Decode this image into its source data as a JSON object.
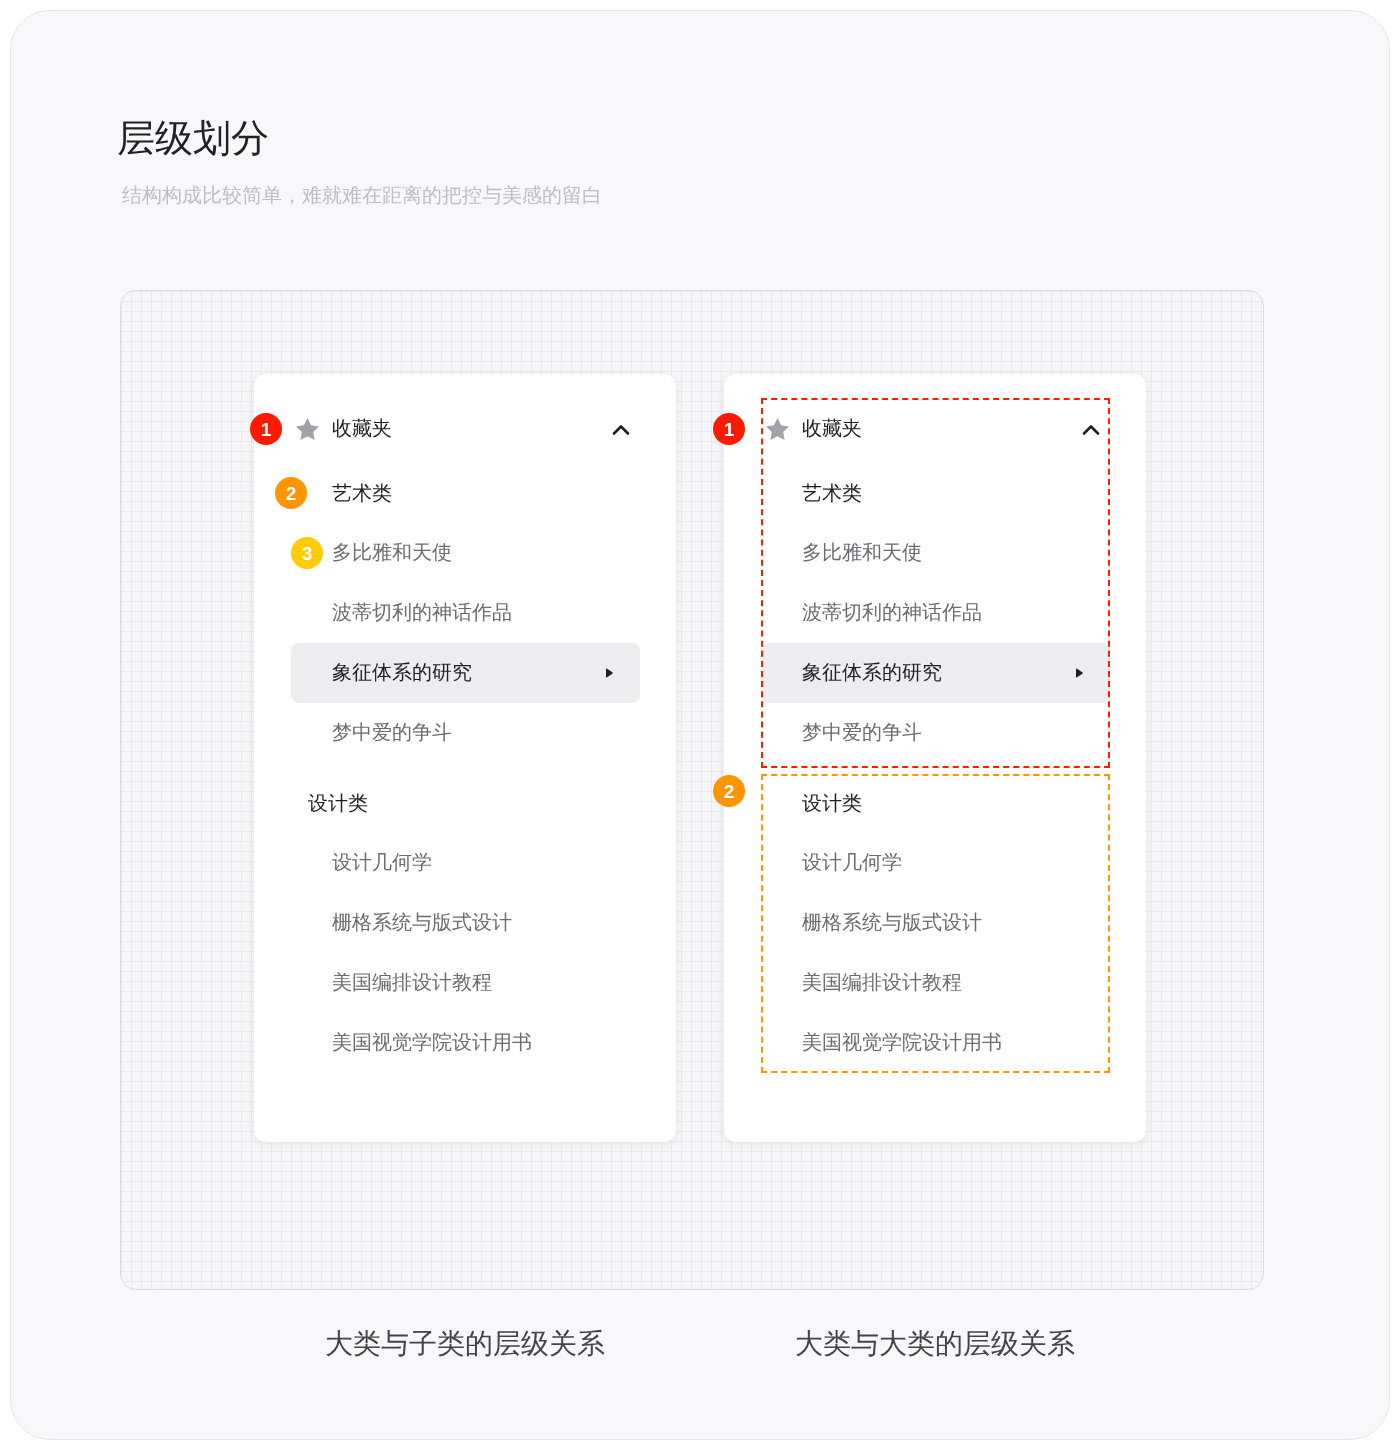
{
  "header": {
    "title": "层级划分",
    "subtitle": "结构构成比较简单，难就难在距离的把控与美感的留白"
  },
  "panels": [
    {
      "kind": "tree",
      "caption": "大类与子类的层级关系",
      "menu": {
        "label": "收藏夹",
        "expanded": true,
        "badge": {
          "label": "1",
          "color": "#ff1a00"
        },
        "children": [
          {
            "label": "艺术类",
            "badge": {
              "label": "2",
              "color": "#ff9500"
            },
            "children": [
              {
                "label": "多比雅和天使",
                "selected": false,
                "badge": {
                  "label": "3",
                  "color": "#ffcc00"
                }
              },
              {
                "label": "波蒂切利的神话作品",
                "selected": false
              },
              {
                "label": "象征体系的研究",
                "selected": true
              },
              {
                "label": "梦中爱的争斗",
                "selected": false
              }
            ]
          },
          {
            "label": "设计类",
            "children": [
              {
                "label": "设计几何学",
                "selected": false
              },
              {
                "label": "栅格系统与版式设计",
                "selected": false
              },
              {
                "label": "美国编排设计教程",
                "selected": false
              },
              {
                "label": "美国视觉学院设计用书",
                "selected": false
              }
            ]
          }
        ]
      }
    },
    {
      "kind": "sections",
      "caption": "大类与大类的层级关系",
      "sections": [
        {
          "badge": "1",
          "color": "#ff1a00",
          "rows": [
            {
              "kind": "header",
              "label": "收藏夹",
              "expanded": true
            },
            {
              "kind": "group",
              "label": "艺术类"
            },
            {
              "kind": "item",
              "label": "多比雅和天使",
              "selected": false
            },
            {
              "kind": "item",
              "label": "波蒂切利的神话作品",
              "selected": false
            },
            {
              "kind": "item",
              "label": "象征体系的研究",
              "selected": true
            },
            {
              "kind": "item",
              "label": "梦中爱的争斗",
              "selected": false
            }
          ]
        },
        {
          "badge": "2",
          "color": "#ff9500",
          "rows": [
            {
              "kind": "group",
              "label": "设计类"
            },
            {
              "kind": "item",
              "label": "设计几何学",
              "selected": false
            },
            {
              "kind": "item",
              "label": "栅格系统与版式设计",
              "selected": false
            },
            {
              "kind": "item",
              "label": "美国编排设计教程",
              "selected": false
            },
            {
              "kind": "item",
              "label": "美国视觉学院设计用书",
              "selected": false
            }
          ]
        }
      ]
    }
  ]
}
